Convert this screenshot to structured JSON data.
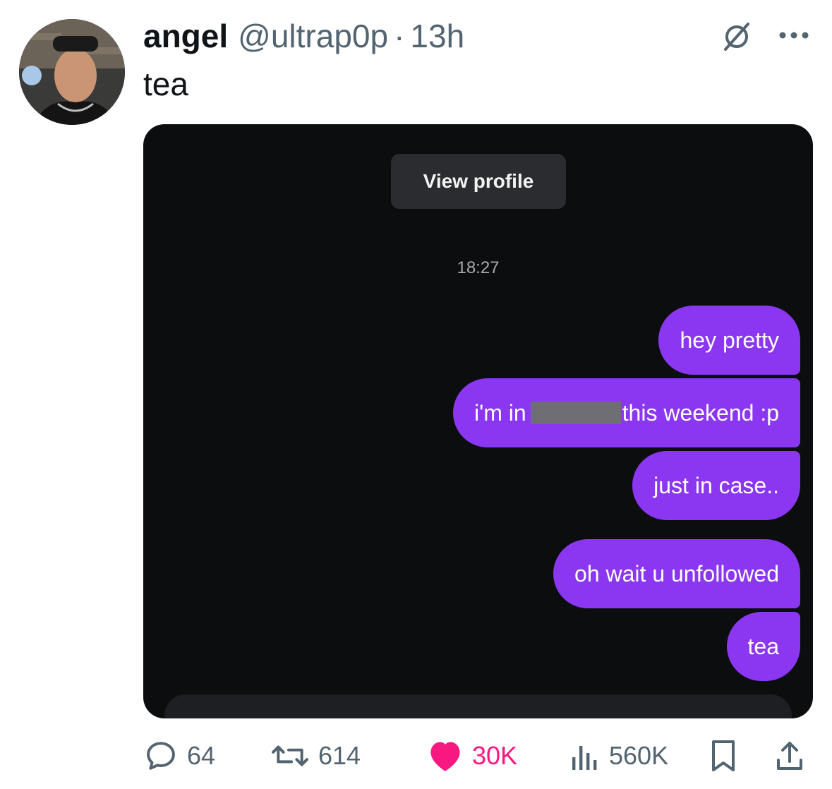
{
  "tweet": {
    "author": {
      "name": "angel",
      "handle": "@ultrap0p",
      "separator": "·",
      "time": "13h",
      "avatar_icon": "profile-photo"
    },
    "text": "tea",
    "header_icons": [
      "grok-icon",
      "more-icon"
    ]
  },
  "media": {
    "view_profile_label": "View profile",
    "timestamp": "18:27",
    "messages": [
      {
        "text": "hey pretty"
      },
      {
        "text_before": "i'm in",
        "redacted": true,
        "text_after": "this weekend :p"
      },
      {
        "text": "just in case.."
      },
      {
        "text": "oh wait u unfollowed"
      },
      {
        "text": "tea"
      }
    ],
    "bubble_color": "#8b37f2",
    "background_color": "#0c0d0f"
  },
  "actions": {
    "replies": "64",
    "retweets": "614",
    "likes": "30K",
    "views": "560K",
    "like_color": "#f91880",
    "icons": [
      "reply-icon",
      "retweet-icon",
      "heart-icon",
      "views-icon",
      "bookmark-icon",
      "share-icon"
    ]
  }
}
